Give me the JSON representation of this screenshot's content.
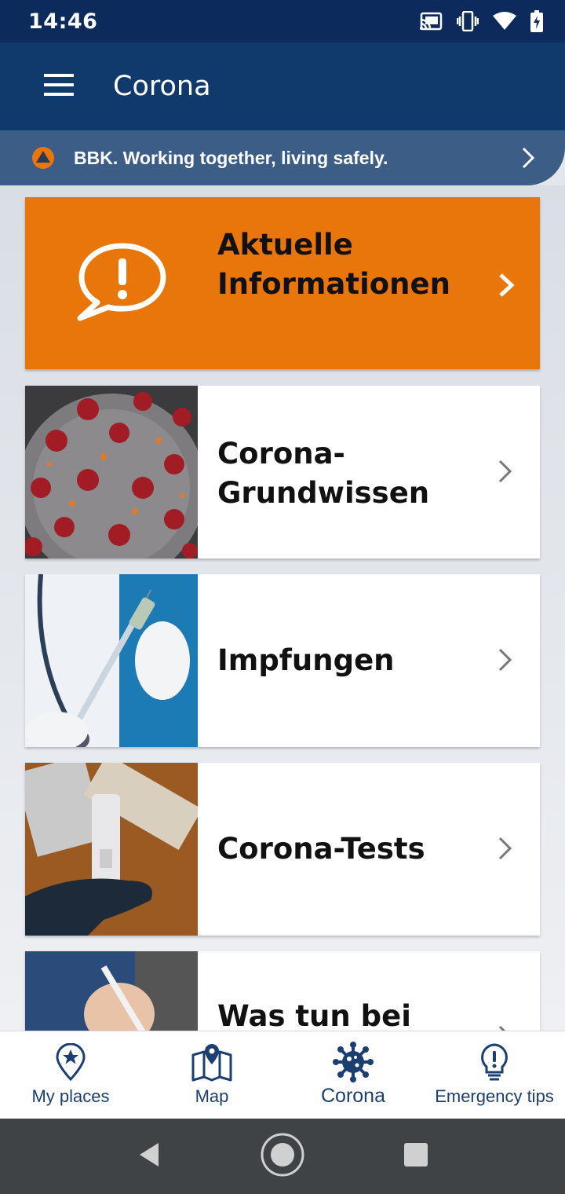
{
  "status_bar": {
    "time": "14:46",
    "icons": [
      "cast-icon",
      "vibrate-icon",
      "wifi-icon",
      "battery-charging-icon"
    ]
  },
  "app_bar": {
    "title": "Corona",
    "menu_icon": "hamburger-menu-icon"
  },
  "banner": {
    "text": "BBK. Working together, living safely.",
    "icon": "bbk-logo-icon",
    "accent": "#e9760a"
  },
  "hero": {
    "title": "Aktuelle Informationen",
    "icon": "exclamation-speech-bubble-icon",
    "color": "#e9760a"
  },
  "cards": [
    {
      "title": "Corona-Grundwissen",
      "image": "coronavirus-image"
    },
    {
      "title": "Impfungen",
      "image": "vaccination-syringe-image"
    },
    {
      "title": "Corona-Tests",
      "image": "antigen-test-image"
    },
    {
      "title": "Was tun bei",
      "image": "thermometer-image"
    }
  ],
  "bottom_nav": {
    "items": [
      {
        "label": "My places",
        "icon": "star-pin-icon",
        "active": false
      },
      {
        "label": "Map",
        "icon": "map-pin-icon",
        "active": false
      },
      {
        "label": "Corona",
        "icon": "virus-icon",
        "active": true
      },
      {
        "label": "Emergency tips",
        "icon": "lightbulb-icon",
        "active": false
      }
    ],
    "color": "#1a3f70"
  },
  "system_nav": [
    "back-icon",
    "home-icon",
    "recents-icon"
  ]
}
